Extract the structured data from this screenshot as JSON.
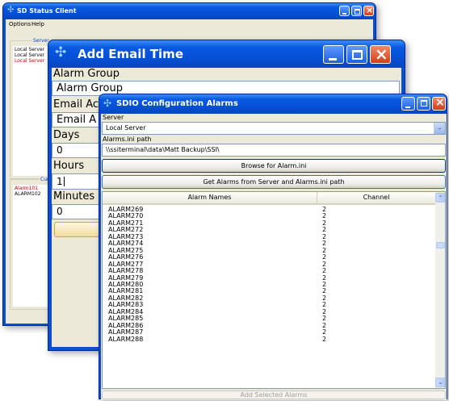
{
  "status_client": {
    "title": "SD Status Client",
    "menu": [
      "Options",
      "Help"
    ],
    "servers_group_label": "Server",
    "servers": [
      {
        "name": "Local Server",
        "color": "#000000"
      },
      {
        "name": "Local Server",
        "color": "#000000"
      },
      {
        "name": "Local Server",
        "color": "#cc0000"
      }
    ],
    "current_group_label": "Curr",
    "current_alarms": [
      {
        "name": "Alarm101",
        "color": "#cc0000"
      },
      {
        "name": "ALARM102",
        "color": "#000000"
      }
    ]
  },
  "email_time": {
    "title": "Add Email Time",
    "alarm_group_label": "Alarm Group",
    "alarm_group_value": "Alarm Group",
    "email_label": "Email Ac",
    "email_value": "Email A",
    "days_label": "Days",
    "days_value": "0",
    "hours_label": "Hours",
    "hours_value": "1",
    "minutes_label": "Minutes",
    "minutes_value": "0"
  },
  "sdio": {
    "title": "SDIO Configuration Alarms",
    "server_label": "Server",
    "server_value": "Local Server",
    "ini_label": "Alarms.ini path",
    "ini_value": "\\\\ssiterminal\\data\\Matt Backup\\SSI\\",
    "browse_button": "Browse for Alarm.ini",
    "get_button": "Get Alarms from Server and Alarms.ini path",
    "col_names": "Alarm Names",
    "col_channel": "Channel",
    "rows": [
      {
        "name": "ALARM269",
        "channel": "2"
      },
      {
        "name": "ALARM270",
        "channel": "2"
      },
      {
        "name": "ALARM271",
        "channel": "2"
      },
      {
        "name": "ALARM272",
        "channel": "2"
      },
      {
        "name": "ALARM273",
        "channel": "2"
      },
      {
        "name": "ALARM274",
        "channel": "2"
      },
      {
        "name": "ALARM275",
        "channel": "2"
      },
      {
        "name": "ALARM276",
        "channel": "2"
      },
      {
        "name": "ALARM277",
        "channel": "2"
      },
      {
        "name": "ALARM278",
        "channel": "2"
      },
      {
        "name": "ALARM279",
        "channel": "2"
      },
      {
        "name": "ALARM280",
        "channel": "2"
      },
      {
        "name": "ALARM281",
        "channel": "2"
      },
      {
        "name": "ALARM282",
        "channel": "2"
      },
      {
        "name": "ALARM283",
        "channel": "2"
      },
      {
        "name": "ALARM284",
        "channel": "2"
      },
      {
        "name": "ALARM285",
        "channel": "2"
      },
      {
        "name": "ALARM286",
        "channel": "2"
      },
      {
        "name": "ALARM287",
        "channel": "2"
      },
      {
        "name": "ALARM288",
        "channel": "2"
      }
    ],
    "add_button": "Add Selected Alarms"
  }
}
